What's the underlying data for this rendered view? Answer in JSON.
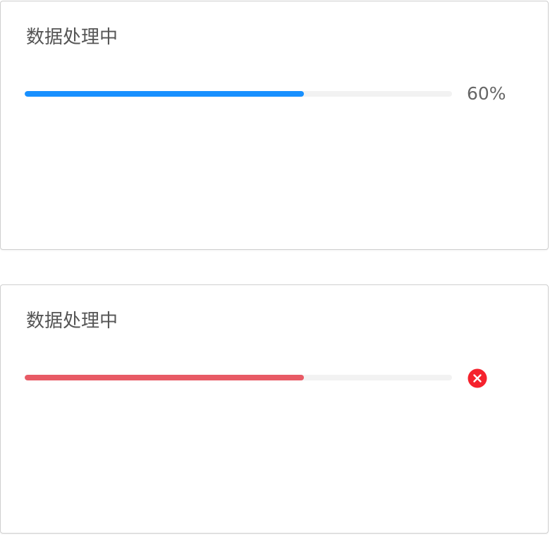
{
  "cards": [
    {
      "title": "数据处理中",
      "progress": 0.654,
      "status": "active",
      "percent_label": "60%",
      "bar_color": "#1890ff"
    },
    {
      "title": "数据处理中",
      "progress": 0.654,
      "status": "exception",
      "bar_color": "#e85a65",
      "status_icon": "close-circle-icon",
      "status_icon_color": "#f5222d"
    }
  ]
}
